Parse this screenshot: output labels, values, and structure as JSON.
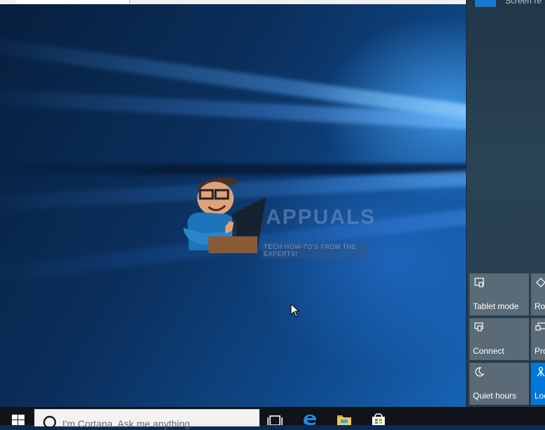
{
  "notification": {
    "text": "Screen re"
  },
  "watermark": {
    "logo": "APPUALS",
    "tagline": "TECH HOW-TO'S FROM THE EXPERTS!"
  },
  "quick_actions": [
    {
      "label": "Tablet mode",
      "icon": "tablet-mode-icon",
      "active": false
    },
    {
      "label": "Rot",
      "icon": "rotation-lock-icon",
      "active": false
    },
    {
      "label": "Connect",
      "icon": "connect-icon",
      "active": false
    },
    {
      "label": "Pro",
      "icon": "project-icon",
      "active": false
    },
    {
      "label": "Quiet hours",
      "icon": "moon-icon",
      "active": false
    },
    {
      "label": "Loc",
      "icon": "location-icon",
      "active": true
    }
  ],
  "taskbar": {
    "search_placeholder": "I'm Cortana. Ask me anything.",
    "icons": [
      "windows-start-icon",
      "cortana-search-icon",
      "task-view-icon",
      "edge-browser-icon",
      "file-explorer-icon",
      "store-icon"
    ]
  },
  "colors": {
    "accent": "#0078d7",
    "tile": "#5a6a76",
    "taskbar": "#101418"
  }
}
